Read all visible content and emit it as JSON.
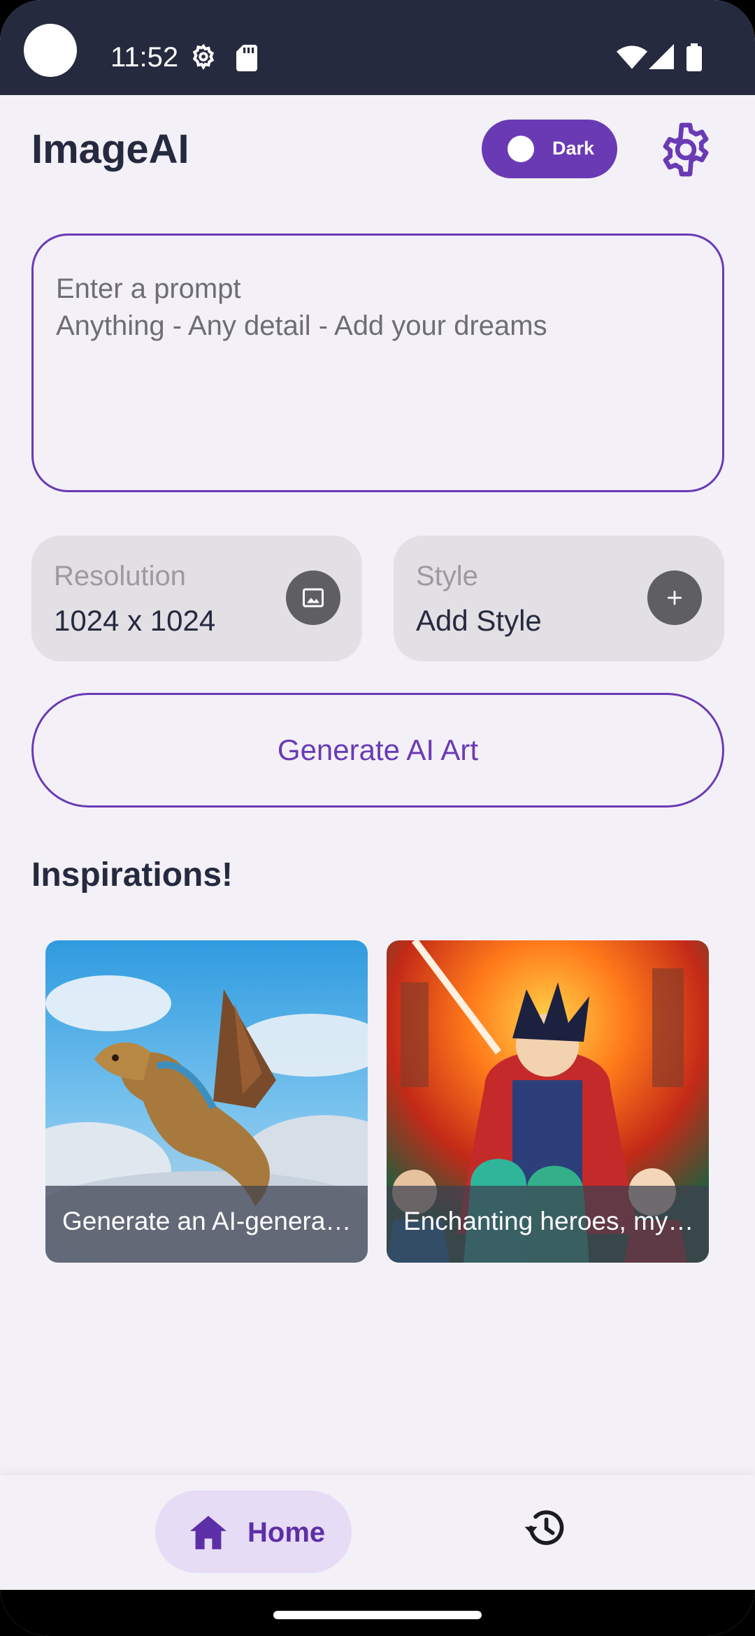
{
  "status_bar": {
    "time": "11:52",
    "icons": [
      "camera-cutout",
      "settings-gear-icon",
      "sd-card-icon",
      "wifi-icon",
      "signal-icon",
      "battery-icon"
    ]
  },
  "header": {
    "title": "ImageAI",
    "theme_toggle_label": "Dark",
    "settings_icon": "gear-icon"
  },
  "prompt": {
    "placeholder": "Enter a prompt\nAnything - Any detail - Add your dreams"
  },
  "options": {
    "resolution": {
      "label": "Resolution",
      "value": "1024 x 1024",
      "icon": "image-icon"
    },
    "style": {
      "label": "Style",
      "value": "Add Style",
      "icon": "plus-icon"
    }
  },
  "generate_button": {
    "label": "Generate AI Art"
  },
  "inspirations": {
    "title": "Inspirations!",
    "items": [
      {
        "caption": "Generate an AI-genera…"
      },
      {
        "caption": "Enchanting heroes, my…"
      }
    ]
  },
  "bottom_nav": {
    "home_label": "Home",
    "home_icon": "home-icon",
    "history_icon": "history-icon"
  },
  "colors": {
    "accent": "#6a3ab5",
    "background": "#f3f1f7",
    "status_bar": "#262a3f",
    "card": "#e2e0e4"
  }
}
